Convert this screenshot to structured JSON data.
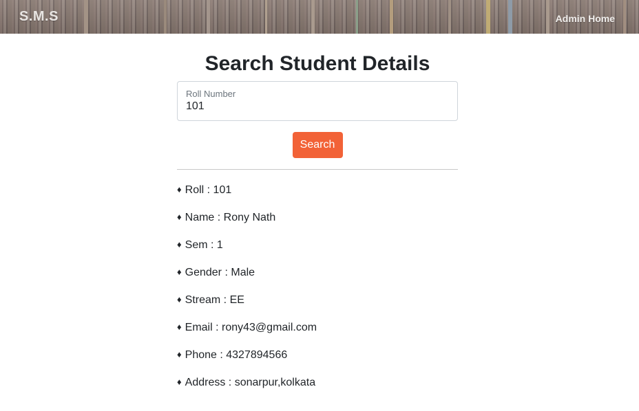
{
  "navbar": {
    "brand": "S.M.S",
    "admin_home": "Admin Home"
  },
  "page": {
    "title": "Search Student Details"
  },
  "search": {
    "label": "Roll Number",
    "value": "101",
    "button_label": "Search",
    "button_color": "#f26237"
  },
  "details": [
    {
      "label": "Roll",
      "value": "101"
    },
    {
      "label": "Name",
      "value": "Rony Nath"
    },
    {
      "label": "Sem",
      "value": "1"
    },
    {
      "label": "Gender",
      "value": "Male"
    },
    {
      "label": "Stream",
      "value": "EE"
    },
    {
      "label": "Email",
      "value": "rony43@gmail.com"
    },
    {
      "label": "Phone",
      "value": "4327894566"
    },
    {
      "label": "Address",
      "value": "sonarpur,kolkata"
    }
  ],
  "bullet_glyph": "♦"
}
